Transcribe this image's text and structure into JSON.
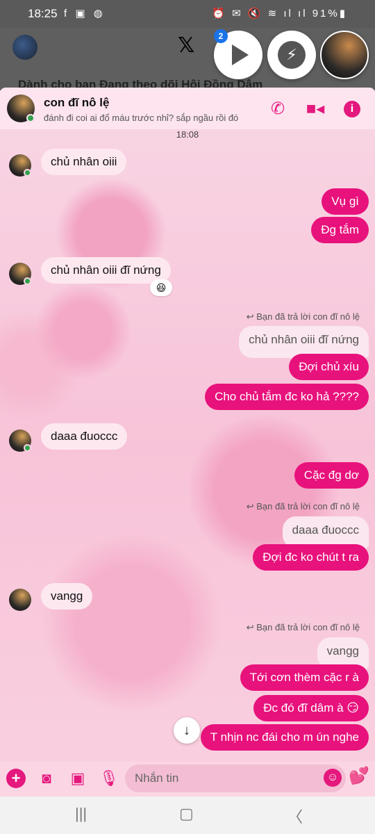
{
  "status_bar": {
    "time": "18:25",
    "apps": "f ▣ ◍",
    "icons": "⏰ ✉ 🔇 ≋ ıl ıl",
    "battery": "91%▮"
  },
  "background": {
    "tabs": "Dành cho bạn    Đang theo dõi    Hội Đồng Dâm"
  },
  "chat_heads": {
    "badge": "2"
  },
  "header": {
    "name": "con đĩ nô lệ",
    "status": "đánh đi coi ai đổ máu trước nhỉ? sắp ngầu rồi đó"
  },
  "chat": {
    "timestamp": "18:08",
    "reply_label": "Bạn đã trả lời con đĩ nô lệ",
    "messages": [
      {
        "text": "chủ nhân oiii"
      },
      {
        "text": "Vụ gì"
      },
      {
        "text": "Đg tắm"
      },
      {
        "text": "chủ nhân oiii đĩ nứng",
        "reaction": "😆"
      },
      {
        "quote": "chủ nhân oiii đĩ nứng"
      },
      {
        "text": "Đợi chủ xíu"
      },
      {
        "text": "Cho chủ tắm đc ko hả ????"
      },
      {
        "text": "daaa đuoccc"
      },
      {
        "text": "Cặc đg dơ"
      },
      {
        "quote": "daaa đuoccc"
      },
      {
        "text": "Đợi đc ko chút t ra"
      },
      {
        "text": "vangg"
      },
      {
        "quote": "vangg"
      },
      {
        "text": "Tới cơn thèm cặc r à"
      },
      {
        "text": "Đc đó đĩ dâm à 😏"
      },
      {
        "text": "T nhịn nc đái cho m ún nghe"
      }
    ]
  },
  "composer": {
    "placeholder": "Nhắn tin"
  }
}
